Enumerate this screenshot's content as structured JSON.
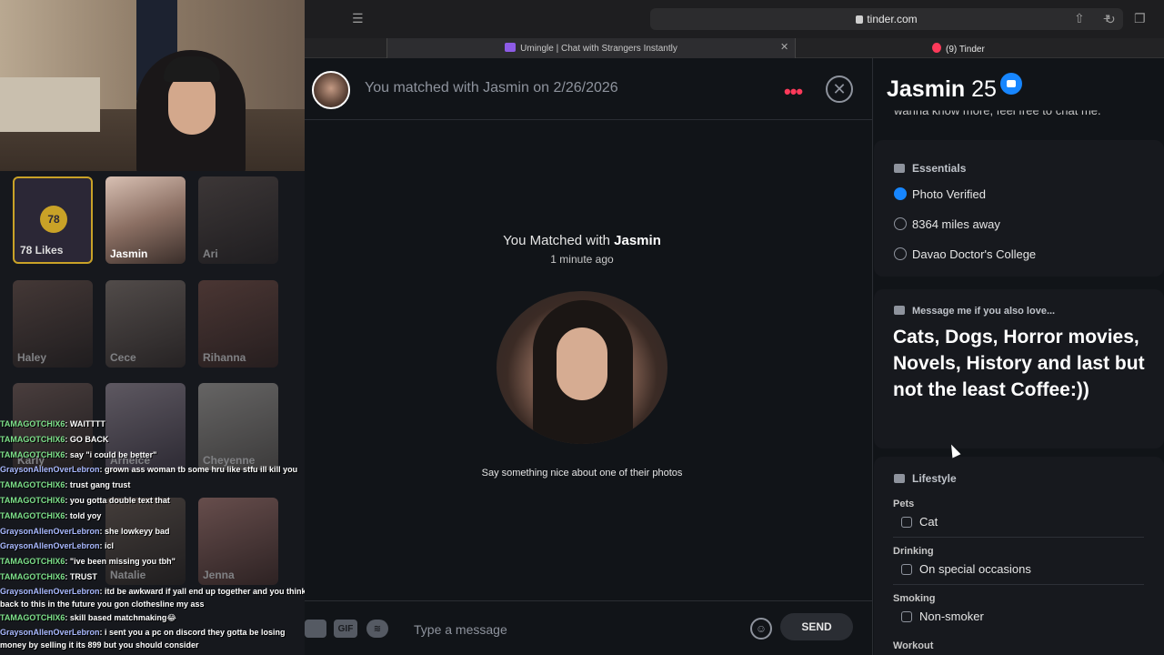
{
  "browser": {
    "url": "tinder.com",
    "tab1_title": "Umingle | Chat with Strangers Instantly",
    "tab2_title": "(9) Tinder"
  },
  "left_panel": {
    "likes": {
      "count": "78",
      "label": "78 Likes"
    },
    "tiles": [
      "Jasmin",
      "Ari",
      "Haley",
      "Cece",
      "Rihanna",
      "Karly",
      "Arneice",
      "Cheyenne",
      "Natalie",
      "Jenna"
    ]
  },
  "stream_chat": [
    {
      "user": "TAMAGOTCHIX6",
      "msg": ": WAITTTT"
    },
    {
      "user": "TAMAGOTCHIX6",
      "msg": ": GO BACK"
    },
    {
      "user": "TAMAGOTCHIX6",
      "msg": ": say \"i could be better\""
    },
    {
      "user": "GraysonAllenOverLebron",
      "msg": ": grown ass woman tb some hru like stfu ill kill you"
    },
    {
      "user": "TAMAGOTCHIX6",
      "msg": ": trust gang trust"
    },
    {
      "user": "TAMAGOTCHIX6",
      "msg": ": you gotta double text that"
    },
    {
      "user": "TAMAGOTCHIX6",
      "msg": ": told yoy"
    },
    {
      "user": "GraysonAllenOverLebron",
      "msg": ": she lowkeyy bad"
    },
    {
      "user": "GraysonAllenOverLebron",
      "msg": ": icl"
    },
    {
      "user": "TAMAGOTCHIX6",
      "msg": ": \"ive been missing you tbh\""
    },
    {
      "user": "TAMAGOTCHIX6",
      "msg": ": TRUST"
    },
    {
      "user": "GraysonAllenOverLebron",
      "msg": ": itd be awkward if yall end up together and you think back to this in the future you gon clothesline my ass"
    },
    {
      "user": "TAMAGOTCHIX6",
      "msg": ": skill based matchmaking😂"
    },
    {
      "user": "GraysonAllenOverLebron",
      "msg": ": i sent you a pc on discord they gotta be losing money by selling it its 899 but you should consider"
    }
  ],
  "chat": {
    "header_text": "You matched with Jasmin on 2/26/2026",
    "matched_prefix": "You Matched with ",
    "matched_name": "Jasmin",
    "matched_time": "1 minute ago",
    "prompt": "Say something nice about one of their photos",
    "input_placeholder": "Type a message",
    "gif_label": "GIF",
    "send_label": "SEND"
  },
  "profile": {
    "name": "Jasmin",
    "age": "25",
    "bio_cut": "wanna know more, feel free to chat me.",
    "essentials_title": "Essentials",
    "essentials": [
      "Photo Verified",
      "8364 miles away",
      "Davao Doctor's College"
    ],
    "quote_title": "Message me if you also love...",
    "quote_text": "Cats, Dogs, Horror movies, Novels, History and last but not the least Coffee:))",
    "lifestyle_title": "Lifestyle",
    "lifestyle": [
      {
        "label": "Pets",
        "value": "Cat"
      },
      {
        "label": "Drinking",
        "value": "On special occasions"
      },
      {
        "label": "Smoking",
        "value": "Non-smoker"
      },
      {
        "label": "Workout",
        "value": ""
      }
    ]
  },
  "colors": {
    "accent": "#fd3a5a",
    "verified": "#1786ff",
    "bg": "#111418"
  }
}
